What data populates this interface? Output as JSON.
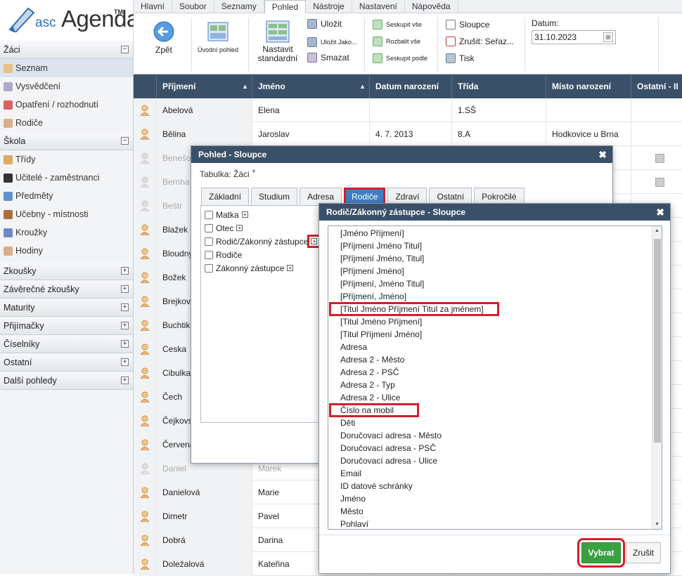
{
  "app": {
    "logo_prefix": "asc",
    "logo_word": "Agenda",
    "logo_tm": "TM"
  },
  "menu_tabs": [
    "Hlavní",
    "Soubor",
    "Seznamy",
    "Pohled",
    "Nástroje",
    "Nastavení",
    "Nápověda"
  ],
  "ribbon": {
    "back": "Zpět",
    "home_view": "Úvodní pohled",
    "set_standard_1": "Nastavit",
    "set_standard_2": "standardní",
    "save": "Uložit",
    "save_as": "Uložit Jako...",
    "delete": "Smazat",
    "group_all": "Seskupit vše",
    "expand_all": "Rozbalit vše",
    "group_by": "Seskupit podle",
    "columns": "Sloupce",
    "cancel_sort": "Zrušit: Seřaz...",
    "print": "Tisk",
    "date_label": "Datum:",
    "date_value": "31.10.2023"
  },
  "sidebar": {
    "zaci": {
      "title": "Žáci",
      "items": [
        "Seznam",
        "Vysvědčení",
        "Opatření / rozhodnutí",
        "Rodiče"
      ]
    },
    "skola": {
      "title": "Škola",
      "items": [
        "Třídy",
        "Učitelé - zaměstnanci",
        "Předměty",
        "Učebny - místnosti",
        "Kroužky",
        "Hodiny"
      ]
    },
    "sections": [
      "Zkoušky",
      "Závěrečné zkoušky",
      "Maturity",
      "Přijímačky",
      "Číselníky",
      "Ostatní",
      "Další pohledy"
    ]
  },
  "grid": {
    "headers": [
      "Příjmení",
      "Jméno",
      "Datum narození",
      "Třída",
      "Místo narození",
      "Ostatní - II"
    ],
    "rows": [
      {
        "surname": "Abelová",
        "name": "Elena",
        "dob": "",
        "cls": "1.SŠ",
        "place": ""
      },
      {
        "surname": "Bělina",
        "name": "Jaroslav",
        "dob": "4. 7. 2013",
        "cls": "8.A",
        "place": "Hodkovice u Brna"
      },
      {
        "surname": "Benešo",
        "name": "",
        "dob": "",
        "cls": "",
        "place": ""
      },
      {
        "surname": "Bernha",
        "name": "",
        "dob": "",
        "cls": "",
        "place": ""
      },
      {
        "surname": "Beštr",
        "name": "",
        "dob": "",
        "cls": "",
        "place": ""
      },
      {
        "surname": "Blažek",
        "name": "",
        "dob": "",
        "cls": "",
        "place": ""
      },
      {
        "surname": "Bloudny",
        "name": "",
        "dob": "",
        "cls": "",
        "place": ""
      },
      {
        "surname": "Božek",
        "name": "",
        "dob": "",
        "cls": "",
        "place": ""
      },
      {
        "surname": "Brejkov",
        "name": "",
        "dob": "",
        "cls": "",
        "place": ""
      },
      {
        "surname": "Buchtik",
        "name": "",
        "dob": "",
        "cls": "",
        "place": ""
      },
      {
        "surname": "Ceska",
        "name": "",
        "dob": "",
        "cls": "",
        "place": ""
      },
      {
        "surname": "Cibulka",
        "name": "",
        "dob": "",
        "cls": "",
        "place": ""
      },
      {
        "surname": "Čech",
        "name": "",
        "dob": "",
        "cls": "",
        "place": ""
      },
      {
        "surname": "Čejkovs",
        "name": "",
        "dob": "",
        "cls": "",
        "place": ""
      },
      {
        "surname": "Červena",
        "name": "",
        "dob": "",
        "cls": "",
        "place": ""
      },
      {
        "surname": "Daniel",
        "name": "Marek",
        "dob": "",
        "cls": "",
        "place": ""
      },
      {
        "surname": "Danielová",
        "name": "Marie",
        "dob": "",
        "cls": "",
        "place": ""
      },
      {
        "surname": "Dimetr",
        "name": "Pavel",
        "dob": "",
        "cls": "",
        "place": ""
      },
      {
        "surname": "Dobrá",
        "name": "Darina",
        "dob": "",
        "cls": "",
        "place": ""
      },
      {
        "surname": "Doležalová",
        "name": "Kateřina",
        "dob": "",
        "cls": "",
        "place": ""
      }
    ]
  },
  "dialog1": {
    "title": "Pohled - Sloupce",
    "table_label": "Tabulka: Žáci",
    "table_plus": "+",
    "tabs": [
      "Základní",
      "Studium",
      "Adresa",
      "Rodiče",
      "Zdraví",
      "Ostatní",
      "Pokročilé"
    ],
    "tree": [
      "Matka",
      "Otec",
      "Rodič/Zákonný zástupce",
      "Rodiče",
      "Zákonný zástupce"
    ]
  },
  "dialog2": {
    "title": "Rodič/Zákonný zástupce - Sloupce",
    "items": [
      "[Jméno Příjmení]",
      "[Příjmení Jméno Titul]",
      "[Příjmení Jméno, Titul]",
      "[Příjmení Jméno]",
      "[Příjmení, Jméno Titul]",
      "[Příjmení, Jméno]",
      "[Titul Jméno Příjmení Titul za jménem]",
      "[Titul Jméno Příjmení]",
      "[Titul Příjmení Jméno]",
      "Adresa",
      "Adresa 2 - Město",
      "Adresa 2 - PSČ",
      "Adresa 2 - Typ",
      "Adresa 2 - Ulice",
      "Číslo na mobil",
      "Děti",
      "Doručovací adresa - Město",
      "Doručovací adresa - PSČ",
      "Doručovací adresa - Ulice",
      "Email",
      "ID datové schránky",
      "Jméno",
      "Město",
      "Pohlaví"
    ],
    "ok": "Vybrat",
    "cancel": "Zrušit"
  },
  "colors": {
    "header": "#3a5068",
    "accent": "#3f7ec2",
    "highlight": "#d2202a",
    "ok": "#3aa140"
  }
}
